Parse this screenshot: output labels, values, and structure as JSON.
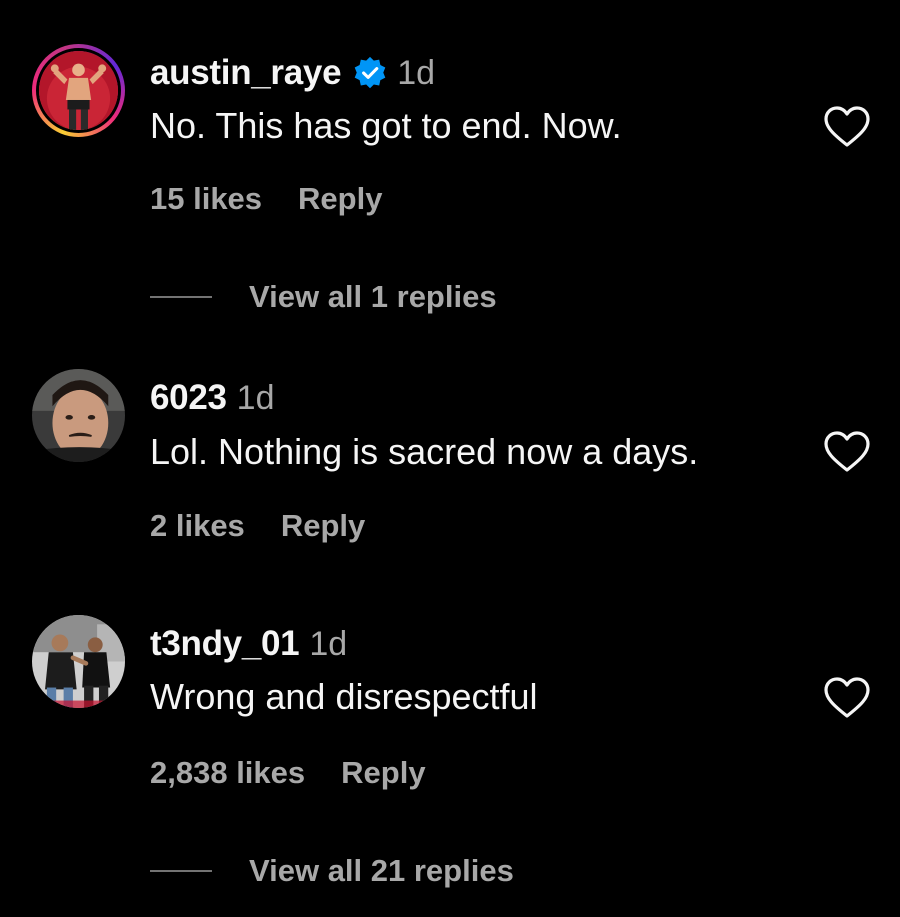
{
  "comments": [
    {
      "username": "austin_raye",
      "verified": true,
      "time": "1d",
      "text": "No. This has got to end. Now.",
      "likes": "15 likes",
      "reply_label": "Reply",
      "view_replies": "View all 1 replies"
    },
    {
      "username": "6023",
      "verified": false,
      "time": "1d",
      "text": "Lol. Nothing is sacred now a days.",
      "likes": "2 likes",
      "reply_label": "Reply"
    },
    {
      "username": "t3ndy_01",
      "verified": false,
      "time": "1d",
      "text": "Wrong and disrespectful",
      "likes": "2,838 likes",
      "reply_label": "Reply",
      "view_replies": "View all 21 replies"
    }
  ],
  "icons": {
    "like": "heart-outline-icon",
    "verified": "verified-badge-icon"
  },
  "colors": {
    "background": "#000000",
    "primary_text": "#f5f5f5",
    "secondary_text": "#a8a8a8",
    "verified_blue": "#0095f6",
    "story_ring": [
      "#f9ce34",
      "#ee2a7b",
      "#6228d7"
    ]
  }
}
